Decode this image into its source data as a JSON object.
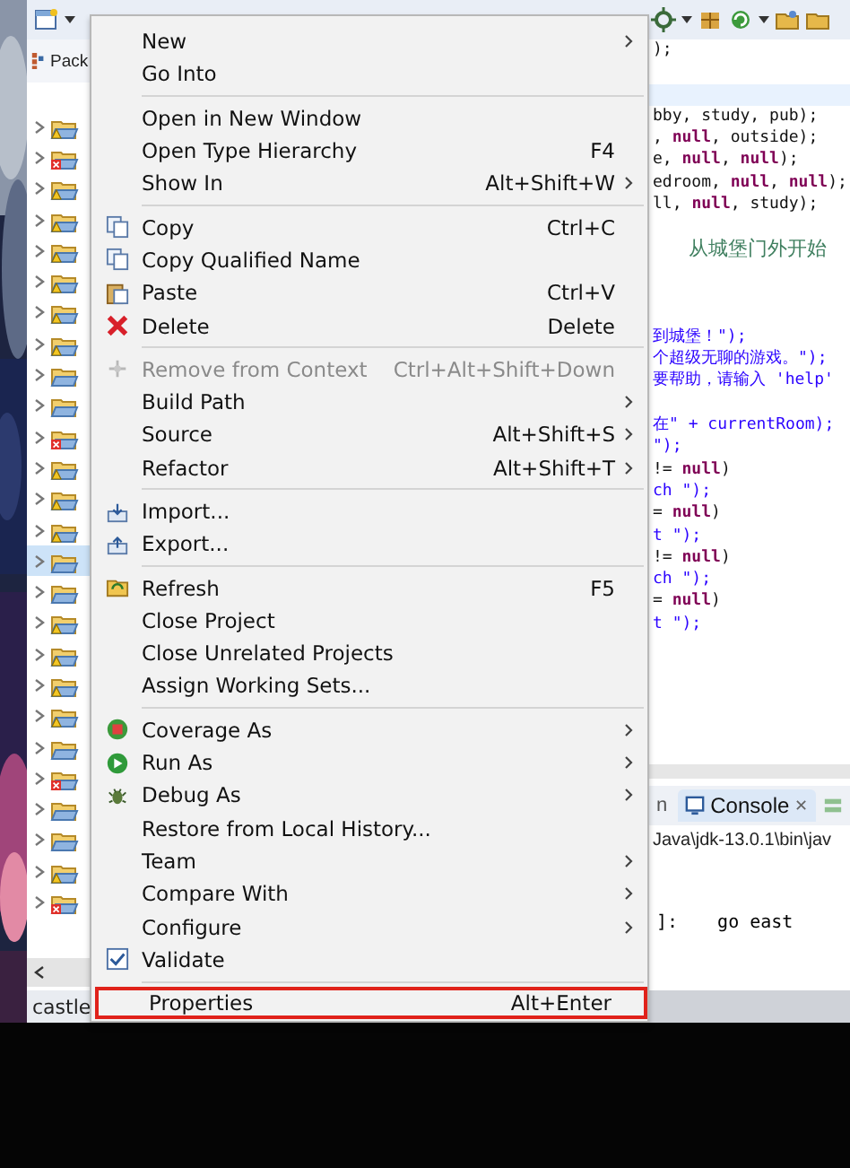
{
  "explorer": {
    "tab": "Pack",
    "items": [
      {
        "kind": "warning",
        "selected": false
      },
      {
        "kind": "error",
        "selected": false
      },
      {
        "kind": "warning",
        "selected": false
      },
      {
        "kind": "warning",
        "selected": false
      },
      {
        "kind": "warning",
        "selected": false
      },
      {
        "kind": "warning",
        "selected": false
      },
      {
        "kind": "warning",
        "selected": false
      },
      {
        "kind": "warning",
        "selected": false
      },
      {
        "kind": "plain",
        "selected": false
      },
      {
        "kind": "plain",
        "selected": false
      },
      {
        "kind": "error",
        "selected": false
      },
      {
        "kind": "warning",
        "selected": false
      },
      {
        "kind": "warning",
        "selected": false
      },
      {
        "kind": "warning",
        "selected": false
      },
      {
        "kind": "plain",
        "selected": true
      },
      {
        "kind": "plain",
        "selected": false
      },
      {
        "kind": "warning",
        "selected": false
      },
      {
        "kind": "warning",
        "selected": false
      },
      {
        "kind": "warning",
        "selected": false
      },
      {
        "kind": "warning",
        "selected": false
      },
      {
        "kind": "plain",
        "selected": false
      },
      {
        "kind": "error",
        "selected": false
      },
      {
        "kind": "plain",
        "selected": false
      },
      {
        "kind": "plain",
        "selected": false
      },
      {
        "kind": "warning",
        "selected": false
      },
      {
        "kind": "error",
        "selected": false
      }
    ]
  },
  "editor": {
    "lines": [
      {
        "kind": "code",
        "text": ");"
      },
      {
        "kind": "blank"
      },
      {
        "kind": "current"
      },
      {
        "kind": "code",
        "text": "bby, study, pub);"
      },
      {
        "kind": "code",
        "text": ", **null**, outside);"
      },
      {
        "kind": "code",
        "text": "e, **null**, **null**);"
      },
      {
        "kind": "code",
        "text": "edroom, **null**, **null**);"
      },
      {
        "kind": "code",
        "text": "ll, **null**, study);"
      },
      {
        "kind": "blank"
      },
      {
        "kind": "comment",
        "text": "从城堡门外开始"
      },
      {
        "kind": "blank"
      },
      {
        "kind": "blank"
      },
      {
        "kind": "blank"
      },
      {
        "kind": "string",
        "text": "到城堡！\");"
      },
      {
        "kind": "string",
        "text": "个超级无聊的游戏。\");"
      },
      {
        "kind": "string",
        "text": "要帮助，请输入 'help'"
      },
      {
        "kind": "blank"
      },
      {
        "kind": "string",
        "text": "在\" + currentRoom);"
      },
      {
        "kind": "string",
        "text": "\");"
      },
      {
        "kind": "code",
        "text": "!= **null**)"
      },
      {
        "kind": "string",
        "text": "ch \");"
      },
      {
        "kind": "code",
        "text": "= **null**)"
      },
      {
        "kind": "string",
        "text": "t \");"
      },
      {
        "kind": "code",
        "text": "!= **null**)"
      },
      {
        "kind": "string",
        "text": "ch \");"
      },
      {
        "kind": "code",
        "text": "= **null**)"
      },
      {
        "kind": "string",
        "text": "t \");"
      }
    ]
  },
  "console": {
    "tabs": [
      {
        "label": "n",
        "selected": false
      },
      {
        "label": "Console",
        "close": "✕",
        "selected": true
      }
    ],
    "path": "Java\\jdk-13.0.1\\bin\\jav",
    "output": [
      {
        "text": "]:"
      },
      {
        "text": "go east"
      }
    ]
  },
  "menu": {
    "groups": [
      [
        {
          "label": "New",
          "submenu": true,
          "disabled": false
        },
        {
          "label": "Go Into",
          "submenu": false,
          "disabled": false
        }
      ],
      [
        {
          "label": "Open in New Window",
          "submenu": false,
          "disabled": false
        },
        {
          "label": "Open Type Hierarchy",
          "shortcut": "F4",
          "submenu": false,
          "disabled": false
        },
        {
          "label": "Show In",
          "shortcut": "Alt+Shift+W",
          "submenu": true,
          "disabled": false
        }
      ],
      [
        {
          "label": "Copy",
          "shortcut": "Ctrl+C",
          "submenu": false,
          "disabled": false
        },
        {
          "label": "Copy Qualified Name",
          "submenu": false,
          "disabled": false
        },
        {
          "label": "Paste",
          "shortcut": "Ctrl+V",
          "submenu": false,
          "disabled": false
        },
        {
          "label": "Delete",
          "shortcut": "Delete",
          "submenu": false,
          "disabled": false
        }
      ],
      [
        {
          "label": "Remove from Context",
          "shortcut": "Ctrl+Alt+Shift+Down",
          "submenu": false,
          "disabled": true
        },
        {
          "label": "Build Path",
          "submenu": true,
          "disabled": false
        },
        {
          "label": "Source",
          "shortcut": "Alt+Shift+S",
          "submenu": true,
          "disabled": false
        },
        {
          "label": "Refactor",
          "shortcut": "Alt+Shift+T",
          "submenu": true,
          "disabled": false
        }
      ],
      [
        {
          "label": "Import...",
          "submenu": false,
          "disabled": false
        },
        {
          "label": "Export...",
          "submenu": false,
          "disabled": false
        }
      ],
      [
        {
          "label": "Refresh",
          "shortcut": "F5",
          "submenu": false,
          "disabled": false
        },
        {
          "label": "Close Project",
          "submenu": false,
          "disabled": false
        },
        {
          "label": "Close Unrelated Projects",
          "submenu": false,
          "disabled": false
        },
        {
          "label": "Assign Working Sets...",
          "submenu": false,
          "disabled": false
        }
      ],
      [
        {
          "label": "Coverage As",
          "submenu": true,
          "disabled": false
        },
        {
          "label": "Run As",
          "submenu": true,
          "disabled": false
        },
        {
          "label": "Debug As",
          "submenu": true,
          "disabled": false
        },
        {
          "label": "Restore from Local History...",
          "submenu": false,
          "disabled": false
        },
        {
          "label": "Team",
          "submenu": true,
          "disabled": false
        },
        {
          "label": "Compare With",
          "submenu": true,
          "disabled": false
        },
        {
          "label": "Configure",
          "submenu": true,
          "disabled": false
        },
        {
          "label": "Validate",
          "submenu": false,
          "disabled": false
        }
      ],
      [
        {
          "label": "Properties",
          "shortcut": "Alt+Enter",
          "submenu": false,
          "disabled": false,
          "highlighted": true
        }
      ]
    ]
  },
  "status_bar": {
    "text": "castle"
  }
}
